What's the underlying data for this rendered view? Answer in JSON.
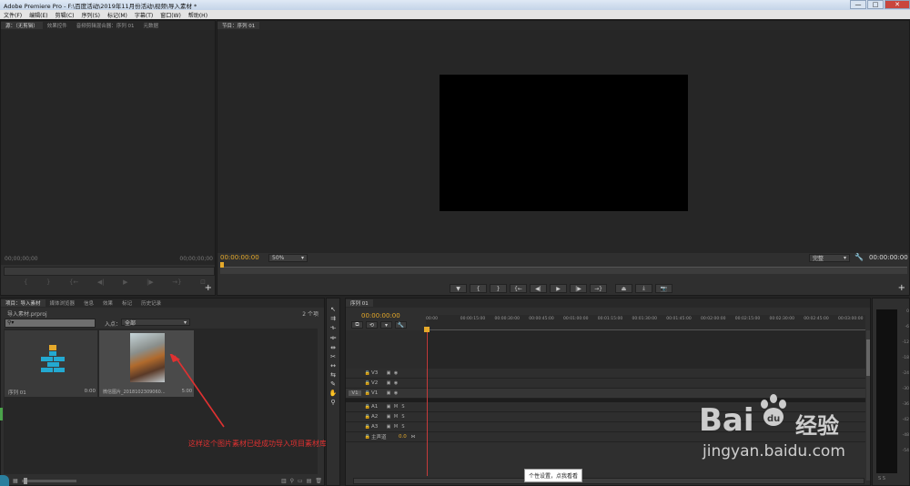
{
  "window": {
    "title": "Adobe Premiere Pro - F:\\百度活动\\2019年11月份活动\\视频\\导入素材 *",
    "minimize": "—",
    "maximize": "□",
    "close": "✕"
  },
  "menu": [
    "文件(F)",
    "编辑(E)",
    "剪辑(C)",
    "序列(S)",
    "标记(M)",
    "字幕(T)",
    "窗口(W)",
    "帮助(H)"
  ],
  "source_panel": {
    "tabs": [
      "源：（无剪辑）",
      "效果控件",
      "音频剪辑混合器：序列 01",
      "元数据"
    ],
    "tc_left": "00;00;00;00",
    "tc_right": "00;00;00;00"
  },
  "program_panel": {
    "tab": "节目：序列 01",
    "timecode": "00:00:00:00",
    "zoom": "50%",
    "quality": "完整",
    "duration": "00:00:00:00"
  },
  "project_panel": {
    "tabs": [
      "项目：导入素材",
      "媒体浏览器",
      "信息",
      "效果",
      "标记",
      "历史记录"
    ],
    "file": "导入素材.prproj",
    "count": "2 个项",
    "search_placeholder": "",
    "in_label": "入点：",
    "in_value": "全部",
    "items": [
      {
        "name": "序列 01",
        "duration": "0:00"
      },
      {
        "name": "微信图片_2018102309060...",
        "duration": "5:00"
      }
    ]
  },
  "annotation": {
    "text": "这样这个图片素材已经成功导入项目素材库",
    "color": "#e03131"
  },
  "timeline": {
    "tab": "序列 01",
    "timecode": "00:00:00:00",
    "ruler": [
      "00:00",
      "00:00:15:00",
      "00:00:30:00",
      "00:00:45:00",
      "00:01:00:00",
      "00:01:15:00",
      "00:01:30:00",
      "00:01:45:00",
      "00:02:00:00",
      "00:02:15:00",
      "00:02:30:00",
      "00:02:45:00",
      "00:03:00:00"
    ],
    "video_tracks": [
      "V3",
      "V2",
      "V1"
    ],
    "audio_tracks": [
      "A1",
      "A2",
      "A3"
    ],
    "master": "主声道",
    "master_val": "0.0",
    "source_patch": "V1",
    "m": "M",
    "s": "S"
  },
  "meter_scale": [
    "0",
    "-6",
    "-12",
    "-18",
    "-24",
    "-30",
    "-36",
    "-42",
    "-48",
    "-54"
  ],
  "tooltip": "个性设置，点我看看",
  "watermark": {
    "brand": "Bai",
    "paw": "du",
    "cn": "经验",
    "url": "jingyan.baidu.com"
  }
}
